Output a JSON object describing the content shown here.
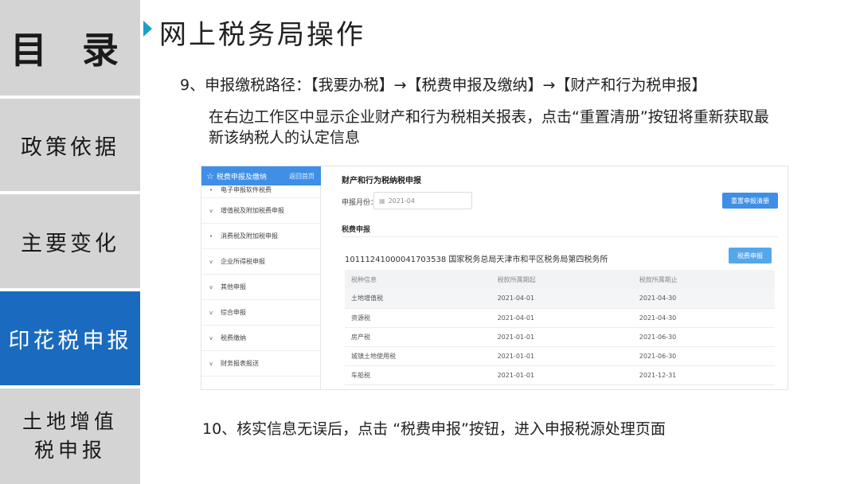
{
  "nav": {
    "mulu": "目 录",
    "zhengce": "政策依据",
    "zhuyao": "主要变化",
    "yinhua": "印花税申报",
    "tudi": "土地增值税申报"
  },
  "page": {
    "title": "网上税务局操作",
    "step9": "9、申报缴税路径：【我要办税】→【税费申报及缴纳】→【财产和行为税申报】",
    "desc": "在右边工作区中显示企业财产和行为税相关报表，点击“重置清册”按钮将重新获取最新该纳税人的认定信息",
    "step10": "10、核实信息无误后，点击 “税费申报”按钮，进入申报税源处理页面"
  },
  "shot": {
    "sidebar": {
      "header": "税费申报及缴纳",
      "back": "返回首页",
      "items": [
        {
          "marker": "•",
          "label": "电子申报软件税费"
        },
        {
          "marker": "v",
          "label": "增值税及附加税费申报"
        },
        {
          "marker": "•",
          "label": "消费税及附加税申报"
        },
        {
          "marker": "v",
          "label": "企业所得税申报"
        },
        {
          "marker": "v",
          "label": "其他申报"
        },
        {
          "marker": "v",
          "label": "综合申报"
        },
        {
          "marker": "v",
          "label": "税费缴纳"
        },
        {
          "marker": "v",
          "label": "财务报表报送"
        }
      ]
    },
    "main": {
      "title": "财产和行为税纳税申报",
      "month_label": "申报月份：",
      "month_value": "2021-04",
      "reset_button": "重置申报清册",
      "section": "税费申报",
      "taxpayer": "1011124100004170353​8 国家税务总局天津市和平区税务局第四税务所",
      "declare_button": "税费申报",
      "table": {
        "headers": [
          "税种信息",
          "税款所属期起",
          "税款所属期止"
        ],
        "rows": [
          [
            "土地增值税",
            "2021-04-01",
            "2021-04-30"
          ],
          [
            "资源税",
            "2021-04-01",
            "2021-04-30"
          ],
          [
            "房产税",
            "2021-01-01",
            "2021-06-30"
          ],
          [
            "城镇土地使用税",
            "2021-01-01",
            "2021-06-30"
          ],
          [
            "车船税",
            "2021-01-01",
            "2021-12-31"
          ]
        ]
      }
    }
  },
  "colors": {
    "nav_active": "#1a6bbf",
    "nav_inactive": "#d4d4d4",
    "accent_button": "#3f8fe6",
    "title_arrow": "#1aa0c8"
  }
}
